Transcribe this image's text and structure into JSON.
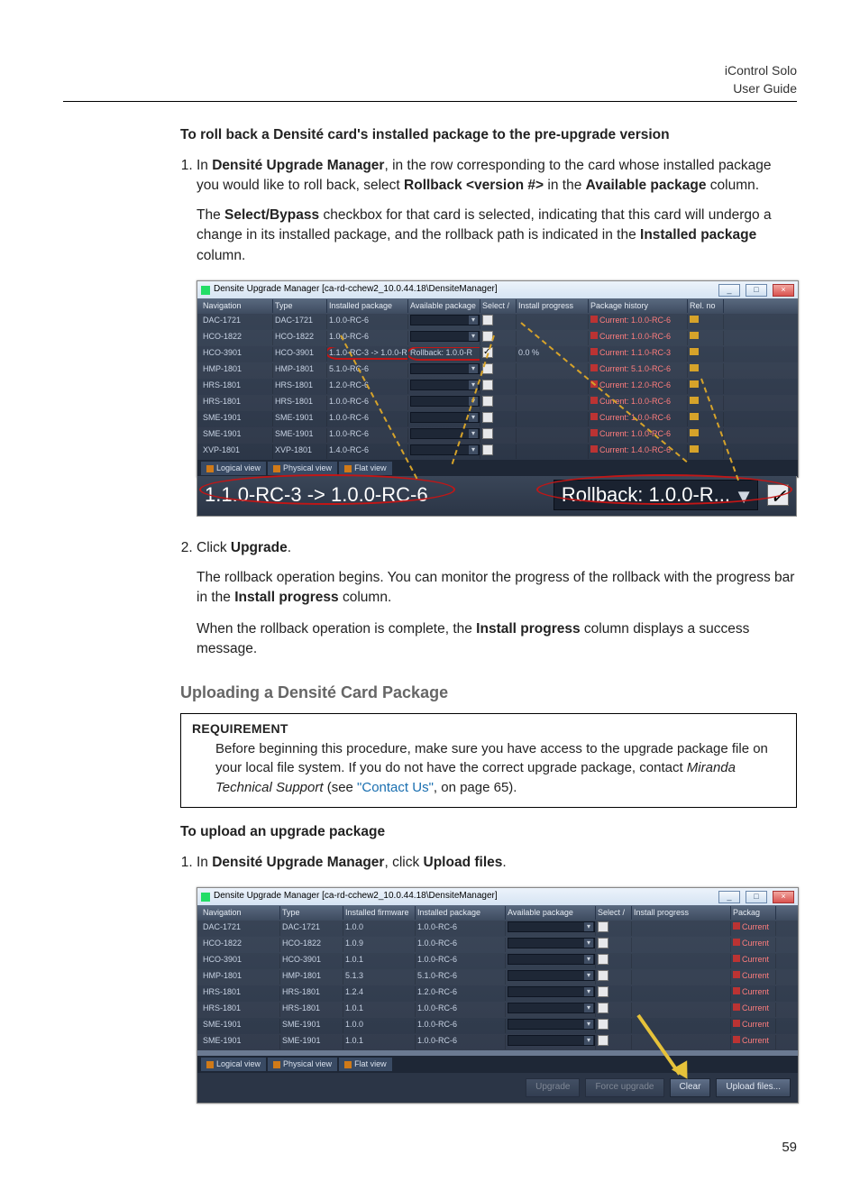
{
  "header": {
    "product": "iControl Solo",
    "doc": "User Guide"
  },
  "page_number": "59",
  "sec_rollback": {
    "title": "To roll back a Densité card's installed package to the pre-upgrade version",
    "step1_a": "In ",
    "step1_b": "Densité Upgrade Manager",
    "step1_c": ", in the row corresponding to the card whose installed package you would like to roll back, select ",
    "step1_d": "Rollback <version #>",
    "step1_e": " in the ",
    "step1_f": "Available package",
    "step1_g": " column.",
    "step1_p2a": "The ",
    "step1_p2b": "Select/Bypass",
    "step1_p2c": " checkbox for that card is selected, indicating that this card will undergo a change in its installed package, and the rollback path is indicated in the ",
    "step1_p2d": "Installed package",
    "step1_p2e": " column.",
    "step2_a": "Click ",
    "step2_b": "Upgrade",
    "step2_c": ".",
    "step2_p2a": "The rollback operation begins. You can monitor the progress of the rollback with the progress bar in the ",
    "step2_p2b": "Install progress",
    "step2_p2c": " column.",
    "step2_p3a": "When the rollback operation is complete, the ",
    "step2_p3b": "Install progress",
    "step2_p3c": " column displays a success message."
  },
  "sec_upload_h2": "Uploading a Densité Card Package",
  "req": {
    "label": "REQUIREMENT",
    "body_a": "Before beginning this procedure, make sure you have access to the upgrade package file on your local file system. If you do not have the correct upgrade package, contact ",
    "body_b": "Miranda Technical Support",
    "body_c": " (see ",
    "body_link": "\"Contact Us\"",
    "body_d": ", on page 65)."
  },
  "sec_upload": {
    "title": "To upload an upgrade package",
    "step1_a": "In ",
    "step1_b": "Densité Upgrade Manager",
    "step1_c": ", click ",
    "step1_d": "Upload files",
    "step1_e": "."
  },
  "sc1": {
    "title": "Densite Upgrade Manager [ca-rd-cchew2_10.0.44.18\\DensiteManager]",
    "cols": [
      "Navigation",
      "Type",
      "Installed package",
      "Available package",
      "Select /",
      "Install progress",
      "Package history",
      "Rel. no"
    ],
    "rows": [
      {
        "nav": "DAC-1721",
        "type": "DAC-1721",
        "ip": "1.0.0-RC-6",
        "hist": "Current: 1.0.0-RC-6"
      },
      {
        "nav": "HCO-1822",
        "type": "HCO-1822",
        "ip": "1.0.0-RC-6",
        "hist": "Current: 1.0.0-RC-6"
      },
      {
        "nav": "HCO-3901",
        "type": "HCO-3901",
        "ip": "1.1.0-RC-3 -> 1.0.0-RC-6",
        "ap": "Rollback: 1.0.0-R",
        "chk": true,
        "prog": "0.0 %",
        "hist": "Current: 1.1.0-RC-3"
      },
      {
        "nav": "HMP-1801",
        "type": "HMP-1801",
        "ip": "5.1.0-RC-6",
        "hist": "Current: 5.1.0-RC-6"
      },
      {
        "nav": "HRS-1801",
        "type": "HRS-1801",
        "ip": "1.2.0-RC-6",
        "hist": "Current: 1.2.0-RC-6"
      },
      {
        "nav": "HRS-1801",
        "type": "HRS-1801",
        "ip": "1.0.0-RC-6",
        "hist": "Current: 1.0.0-RC-6"
      },
      {
        "nav": "SME-1901",
        "type": "SME-1901",
        "ip": "1.0.0-RC-6",
        "hist": "Current: 1.0.0-RC-6"
      },
      {
        "nav": "SME-1901",
        "type": "SME-1901",
        "ip": "1.0.0-RC-6",
        "hist": "Current: 1.0.0-RC-6"
      },
      {
        "nav": "XVP-1801",
        "type": "XVP-1801",
        "ip": "1.4.0-RC-6",
        "hist": "Current: 1.4.0-RC-6"
      }
    ],
    "tabs": [
      "Logical view",
      "Physical view",
      "Flat view"
    ],
    "zoom_ip": "1.1.0-RC-3 -> 1.0.0-RC-6",
    "zoom_ap": "Rollback: 1.0.0-R..."
  },
  "sc2": {
    "title": "Densite Upgrade Manager [ca-rd-cchew2_10.0.44.18\\DensiteManager]",
    "cols": [
      "Navigation",
      "Type",
      "Installed firmware",
      "Installed package",
      "Available package",
      "Select /",
      "Install progress",
      "Packag"
    ],
    "rows": [
      {
        "nav": "DAC-1721",
        "type": "DAC-1721",
        "fw": "1.0.0",
        "ip": "1.0.0-RC-6",
        "hist": "Current"
      },
      {
        "nav": "HCO-1822",
        "type": "HCO-1822",
        "fw": "1.0.9",
        "ip": "1.0.0-RC-6",
        "hist": "Current"
      },
      {
        "nav": "HCO-3901",
        "type": "HCO-3901",
        "fw": "1.0.1",
        "ip": "1.0.0-RC-6",
        "hist": "Current"
      },
      {
        "nav": "HMP-1801",
        "type": "HMP-1801",
        "fw": "5.1.3",
        "ip": "5.1.0-RC-6",
        "hist": "Current"
      },
      {
        "nav": "HRS-1801",
        "type": "HRS-1801",
        "fw": "1.2.4",
        "ip": "1.2.0-RC-6",
        "hist": "Current"
      },
      {
        "nav": "HRS-1801",
        "type": "HRS-1801",
        "fw": "1.0.1",
        "ip": "1.0.0-RC-6",
        "hist": "Current"
      },
      {
        "nav": "SME-1901",
        "type": "SME-1901",
        "fw": "1.0.0",
        "ip": "1.0.0-RC-6",
        "hist": "Current"
      },
      {
        "nav": "SME-1901",
        "type": "SME-1901",
        "fw": "1.0.1",
        "ip": "1.0.0-RC-6",
        "hist": "Current"
      }
    ],
    "tabs": [
      "Logical view",
      "Physical view",
      "Flat view"
    ],
    "buttons": {
      "upgrade": "Upgrade",
      "force": "Force upgrade",
      "clear": "Clear",
      "upload": "Upload files..."
    }
  }
}
